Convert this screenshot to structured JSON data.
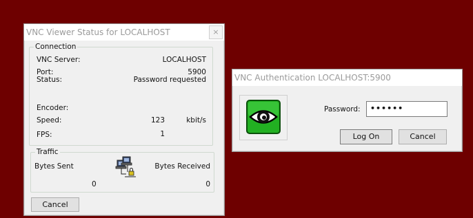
{
  "status_window": {
    "title": "VNC Viewer Status for LOCALHOST",
    "close_glyph": "×",
    "connection": {
      "legend": "Connection",
      "server_label": "VNC Server:",
      "server_value": "LOCALHOST",
      "port_label": "Port:",
      "port_value": "5900",
      "status_label": "Status:",
      "status_value": "Password requested",
      "encoder_label": "Encoder:",
      "encoder_value": "",
      "speed_label": "Speed:",
      "speed_value": "123",
      "speed_unit": "kbit/s",
      "fps_label": "FPS:",
      "fps_value": "1"
    },
    "traffic": {
      "legend": "Traffic",
      "sent_label": "Bytes Sent",
      "received_label": "Bytes Received",
      "sent_value": "0",
      "received_value": "0",
      "icon": "network-computers-icon"
    },
    "cancel_label": "Cancel"
  },
  "auth_window": {
    "title": "VNC Authentication   LOCALHOST:5900",
    "logo_icon": "eye-icon",
    "password_label": "Password:",
    "password_value": "••••••",
    "logon_label": "Log On",
    "cancel_label": "Cancel"
  },
  "colors": {
    "desktop": "#6e0000",
    "logo_green": "#22b022"
  }
}
